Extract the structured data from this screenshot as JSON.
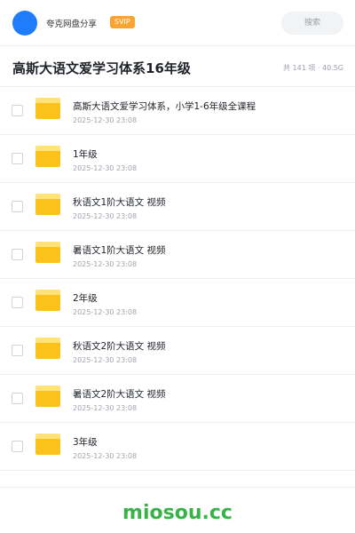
{
  "header": {
    "app_title": "夸克网盘分享",
    "badge": "SVIP",
    "search_placeholder": "搜索",
    "accent_color": "#1f7dfb",
    "badge_color": "#f7a432"
  },
  "folder": {
    "title": "高斯大语文爱学习体系16年级",
    "stats": "共 141 项 · 40.5G"
  },
  "items": [
    {
      "name": "高斯大语文爱学习体系，小学1-6年级全课程",
      "date": "2025-12-30 23:08",
      "icon": "folder-icon"
    },
    {
      "name": "1年级",
      "date": "2025-12-30 23:08",
      "icon": "folder-icon"
    },
    {
      "name": "秋语文1阶大语文 视频",
      "date": "2025-12-30 23:08",
      "icon": "folder-icon"
    },
    {
      "name": "暑语文1阶大语文 视频",
      "date": "2025-12-30 23:08",
      "icon": "folder-icon"
    },
    {
      "name": "2年级",
      "date": "2025-12-30 23:08",
      "icon": "folder-icon"
    },
    {
      "name": "秋语文2阶大语文 视频",
      "date": "2025-12-30 23:08",
      "icon": "folder-icon"
    },
    {
      "name": "暑语文2阶大语文 视频",
      "date": "2025-12-30 23:08",
      "icon": "folder-icon"
    },
    {
      "name": "3年级",
      "date": "2025-12-30 23:08",
      "icon": "folder-icon"
    }
  ],
  "watermark": {
    "text": "miosou.cc",
    "color": "#3bb14a"
  }
}
